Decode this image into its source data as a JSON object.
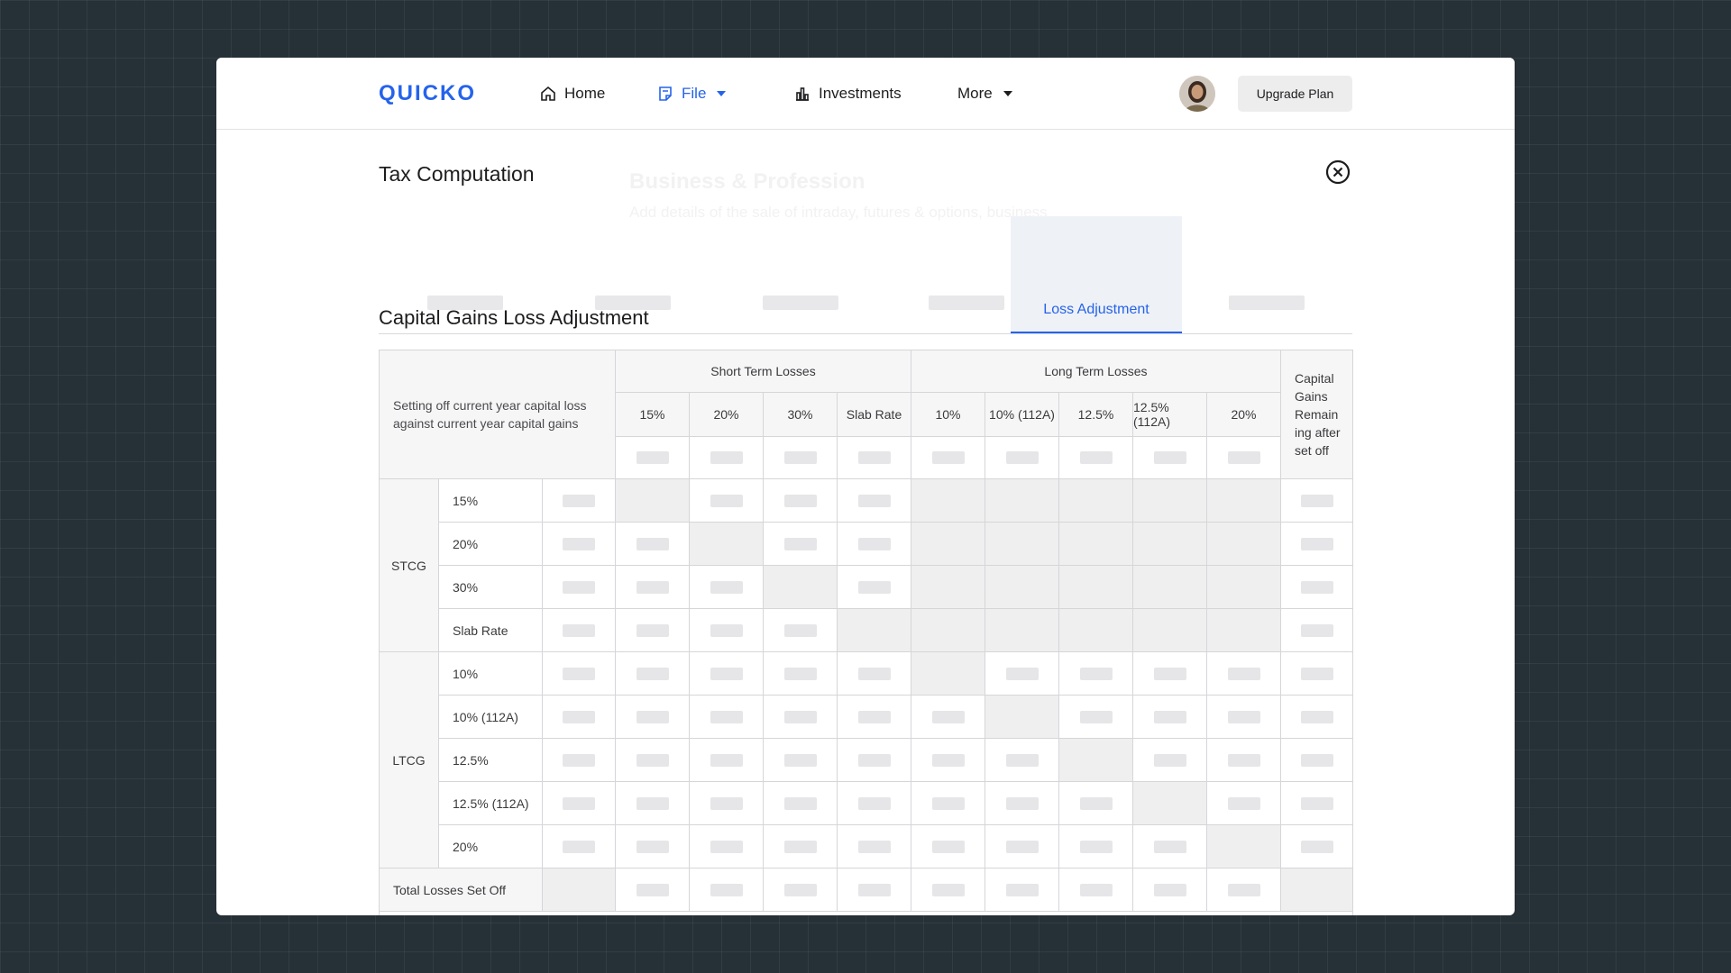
{
  "nav": {
    "logo": "QUICKO",
    "home": "Home",
    "file": "File",
    "investments": "Investments",
    "more": "More",
    "upgrade": "Upgrade Plan"
  },
  "background_ghost": {
    "title": "Business & Profession",
    "subtitle": "Add details of the sale of intraday, futures & options, business"
  },
  "modal": {
    "title": "Tax Computation",
    "active_tab": "Loss Adjustment",
    "section_title": "Capital Gains Loss Adjustment"
  },
  "table": {
    "corner_label": "Setting off current year capital loss against current year capital gains",
    "short_term_header": "Short Term Losses",
    "long_term_header": "Long Term Losses",
    "remaining_header": "Capital Gains Remain ing after set off",
    "rate_columns": [
      "15%",
      "20%",
      "30%",
      "Slab Rate",
      "10%",
      "10% (112A)",
      "12.5%",
      "12.5% (112A)",
      "20%"
    ],
    "groups": [
      {
        "label": "STCG",
        "rows": [
          "15%",
          "20%",
          "30%",
          "Slab Rate"
        ]
      },
      {
        "label": "LTCG",
        "rows": [
          "10%",
          "10% (112A)",
          "12.5%",
          "12.5% (112A)",
          "20%"
        ]
      }
    ],
    "total_row": "Total Losses Set Off"
  },
  "colors": {
    "accent": "#2563eb",
    "background": "#253037",
    "disabled_cell": "#efefef"
  }
}
